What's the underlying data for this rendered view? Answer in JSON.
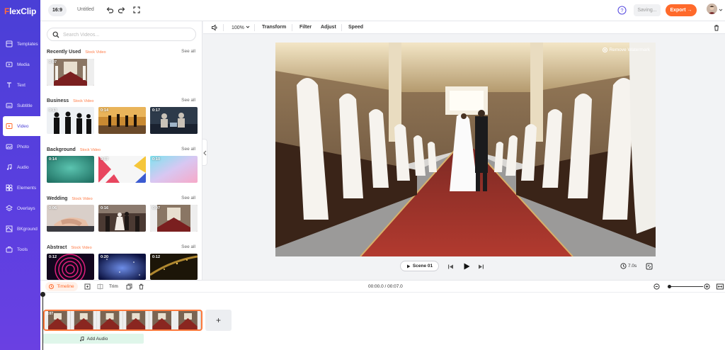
{
  "brand": {
    "logo_letter": "F",
    "logo_rest": "lexClip",
    "accent": "#ff6a2b",
    "sidebar_color": "#4a3fd6"
  },
  "topbar": {
    "ratio": "16:9",
    "title": "Untitled",
    "saving": "Saving...",
    "export": "Export →"
  },
  "sidebar": {
    "items": [
      {
        "label": "Templates",
        "icon": "templates-icon"
      },
      {
        "label": "Media",
        "icon": "media-icon"
      },
      {
        "label": "Text",
        "icon": "text-icon"
      },
      {
        "label": "Subtitle",
        "icon": "subtitle-icon"
      },
      {
        "label": "Video",
        "icon": "video-icon",
        "active": true
      },
      {
        "label": "Photo",
        "icon": "photo-icon"
      },
      {
        "label": "Audio",
        "icon": "audio-icon"
      },
      {
        "label": "Elements",
        "icon": "elements-icon"
      },
      {
        "label": "Overlays",
        "icon": "overlays-icon"
      },
      {
        "label": "BKground",
        "icon": "background-icon"
      },
      {
        "label": "Tools",
        "icon": "tools-icon"
      }
    ]
  },
  "media": {
    "search_placeholder": "Search Videos...",
    "see_all": "See all",
    "sections": [
      {
        "title": "Recently Used",
        "badge": "Stock Video",
        "thumbs": [
          "0:07"
        ]
      },
      {
        "title": "Business",
        "badge": "Stock Video",
        "thumbs": [
          "0:13",
          "0:14",
          "0:17"
        ]
      },
      {
        "title": "Background",
        "badge": "Stock Video",
        "thumbs": [
          "0:14",
          "0:07",
          "0:10"
        ]
      },
      {
        "title": "Wedding",
        "badge": "Stock Video",
        "thumbs": [
          "0:06",
          "0:16",
          "0:07"
        ]
      },
      {
        "title": "Abstract",
        "badge": "Stock Video",
        "thumbs": [
          "0:12",
          "0:20",
          "0:12"
        ]
      }
    ]
  },
  "editor": {
    "zoom": "100%",
    "tools": [
      "Transform",
      "Filter",
      "Adjust",
      "Speed"
    ],
    "watermark": "Remove Watermark"
  },
  "player": {
    "scene": "Scene 01",
    "duration": "7.0s"
  },
  "timeline": {
    "label": "Timeline",
    "trim": "Trim",
    "time": "00:00.0 / 00:07.0",
    "zoom_level": 0.0,
    "clip_duration": "0:07",
    "add_audio": "Add Audio",
    "add_clip": "+"
  }
}
